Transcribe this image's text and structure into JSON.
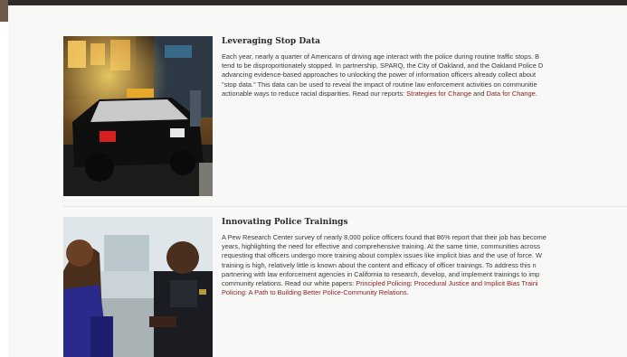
{
  "articles": [
    {
      "title": "Leveraging Stop Data",
      "photo": "police-car-at-night-photo",
      "lines": [
        "Each year, nearly a quarter of Americans of driving age interact with the police during routine traffic stops. B",
        "tend to be disproportionately stopped. In partnership, SPARQ, the City of Oakland, and the Oakland Police D",
        "advancing evidence-based approaches to unlocking the power of information officers already collect about",
        "\"stop data.\" This data can be used to reveal the impact of routine law enforcement activities on communitie"
      ],
      "last_line": {
        "prefix": "actionable ways to reduce racial disparities. Read our reports: ",
        "link1": "Strategies for Change",
        "middle": " and ",
        "link2": "Data for Change",
        "suffix": "."
      }
    },
    {
      "title": "Innovating Police Trainings",
      "photo": "officer-and-woman-talking-photo",
      "lines": [
        "A Pew Research Center survey of nearly 8,000 police officers found that 86% report that their job has become",
        "years, highlighting the need for effective and comprehensive training. At the same time, communities across",
        "requesting that officers undergo more training about complex issues like implicit bias and the use of force. W",
        "training is high, relatively little is known about the content and efficacy of officer trainings. To address this n",
        "partnering with law enforcement agencies in California to research, develop, and implement trainings to imp"
      ],
      "link_line": {
        "prefix": "community relations. Read our white papers: ",
        "link1": "Principled Policing: Procedural Justice and Implicit Bias Traini"
      },
      "link_line2": {
        "link2": "Policing: A Path to Building Better Police-Community Relations",
        "suffix": "."
      }
    }
  ]
}
